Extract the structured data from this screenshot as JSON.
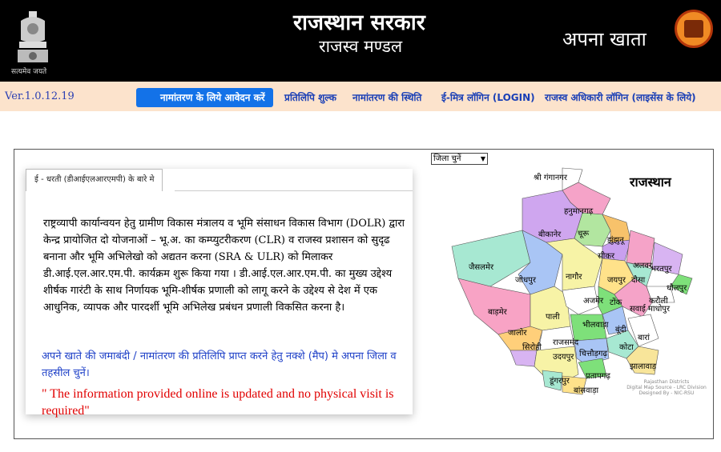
{
  "header": {
    "emblem_motto": "सत्यमेव जयते",
    "title": "राजस्थान सरकार",
    "subtitle": "राजस्व मण्डल",
    "app_name": "अपना खाता"
  },
  "nav": {
    "version": "Ver.1.0.12.19",
    "items": [
      {
        "label": "नामांतरण के लिये आवेदन करें",
        "active": true
      },
      {
        "label": "प्रतिलिपि शुल्क"
      },
      {
        "label": "नामांतरण की स्थिति"
      },
      {
        "label": "ई-मित्र लॉगिन (LOGIN)"
      },
      {
        "label": "राजस्व अधिकारी लॉगिन (लाइसेंस के लिये)"
      }
    ]
  },
  "district_select": {
    "selected": "जिला चुनें"
  },
  "info_card": {
    "tab_label": "ई - धरती (डीआईएलआरएमपी) के बारे मे",
    "paragraph": "राष्ट्रव्यापी कार्यान्वयन हेतु ग्रामीण विकास मंत्रालय व भूमि संसाधन विकास विभाग (DOLR) द्वारा केन्द्र प्रायोजित दो योजनाओं – भू.अ. का कम्प्युटरीकरण (CLR) व राजस्व प्रशासन को सुदृढ बनाना और भूमि अभिलेखो को अद्यतन करना (SRA & ULR) को मिलाकर डी.आई.एल.आर.एम.पी. कार्यक्रम शुरू किया गया । डी.आई.एल.आर.एम.पी. का मुख्य उद्देश्य शीर्षक गारंटी के साथ निर्णायक भूमि-शीर्षक प्रणाली को लागू करने के उद्देश्य से देश में एक आधुनिक, व्यापक और पारदर्शी भूमि अभिलेख प्रबंधन प्रणाली विकसित करना है।",
    "instruction": "अपने खाते की जमाबंदी / नामांतरण की प्रतिलिपि प्राप्त करने हेतु नक्शे (मैप) मे अपना जिला व तहसील चुनें।",
    "notice": "\" The information provided online is updated and no physical visit is required\""
  },
  "map": {
    "title": "राजस्थान",
    "credit": [
      "Rajasthan Districts",
      "Digital Map Source - LRC Division",
      "Designed By - NIC-RSU"
    ],
    "districts": [
      {
        "name": "श्री गंगानगर",
        "color": "#ffffff"
      },
      {
        "name": "हनुमानगढ़",
        "color": "#f5a3c8"
      },
      {
        "name": "बीकानेर",
        "color": "#cfa6ef"
      },
      {
        "name": "चूरू",
        "color": "#b2e6a0"
      },
      {
        "name": "झुंझुनू",
        "color": "#f7c26b"
      },
      {
        "name": "सीकर",
        "color": "#c9a0ef"
      },
      {
        "name": "अलवर",
        "color": "#f5a3c8"
      },
      {
        "name": "भरतपुर",
        "color": "#d8b4f2"
      },
      {
        "name": "जैसलमेर",
        "color": "#a7e8d2"
      },
      {
        "name": "जोधपुर",
        "color": "#a9c5f5"
      },
      {
        "name": "नागौर",
        "color": "#f7f3a6"
      },
      {
        "name": "जयपुर",
        "color": "#ffe28a"
      },
      {
        "name": "दौसा",
        "color": "#a7e8d2"
      },
      {
        "name": "धौलपुर",
        "color": "#7ee07a"
      },
      {
        "name": "करौली",
        "color": "#ffffff"
      },
      {
        "name": "बाड़मेर",
        "color": "#f8a3c5"
      },
      {
        "name": "पाली",
        "color": "#f7f3a6"
      },
      {
        "name": "अजमेर",
        "color": "#ffffff"
      },
      {
        "name": "टोंक",
        "color": "#7ee07a"
      },
      {
        "name": "सवाई माधोपुर",
        "color": "#f5a3c8"
      },
      {
        "name": "जालोर",
        "color": "#ffcf7a"
      },
      {
        "name": "सिरोही",
        "color": "#d8b4f2"
      },
      {
        "name": "राजसमंद",
        "color": "#ffffff"
      },
      {
        "name": "भीलवाड़ा",
        "color": "#7ee07a"
      },
      {
        "name": "बूंदी",
        "color": "#a9c5f5"
      },
      {
        "name": "बारां",
        "color": "#ffffff"
      },
      {
        "name": "कोटा",
        "color": "#a7e8d2"
      },
      {
        "name": "उदयपुर",
        "color": "#f7f3a6"
      },
      {
        "name": "चित्तौड़गढ़",
        "color": "#a9c5f5"
      },
      {
        "name": "झालावाड़",
        "color": "#f8e59a"
      },
      {
        "name": "प्रतापगढ़",
        "color": "#7ee07a"
      },
      {
        "name": "डूंगरपुर",
        "color": "#a7e8d2"
      },
      {
        "name": "बांसवाड़ा",
        "color": "#ffe28a"
      }
    ]
  }
}
